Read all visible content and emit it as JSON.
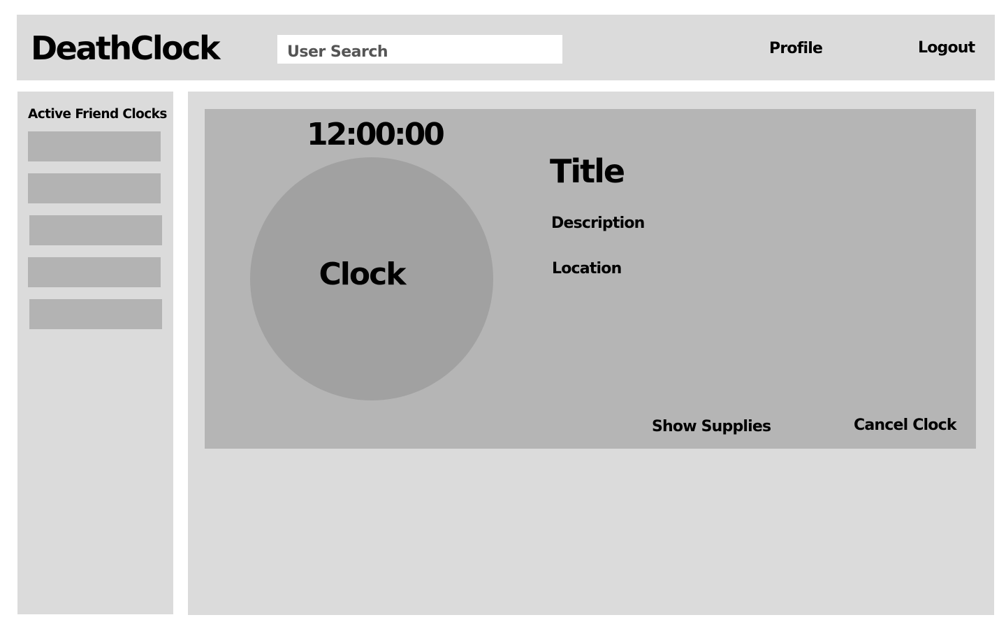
{
  "header": {
    "app_title": "DeathClock",
    "search_placeholder": "User Search",
    "nav": {
      "profile_label": "Profile",
      "logout_label": "Logout"
    }
  },
  "sidebar": {
    "title": "Active Friend Clocks",
    "items": [
      {
        "label": ""
      },
      {
        "label": ""
      },
      {
        "label": ""
      },
      {
        "label": ""
      },
      {
        "label": ""
      }
    ]
  },
  "clock_card": {
    "timer": "12:00:00",
    "clock_label": "Clock",
    "title": "Title",
    "description": "Description",
    "location": "Location",
    "show_supplies_label": "Show Supplies",
    "cancel_clock_label": "Cancel Clock"
  },
  "colors": {
    "page_background": "#ffffff",
    "panel_background": "#dbdbdb",
    "card_background": "#b5b5b5",
    "clock_circle": "#a1a1a1",
    "list_item": "#b3b3b3"
  }
}
